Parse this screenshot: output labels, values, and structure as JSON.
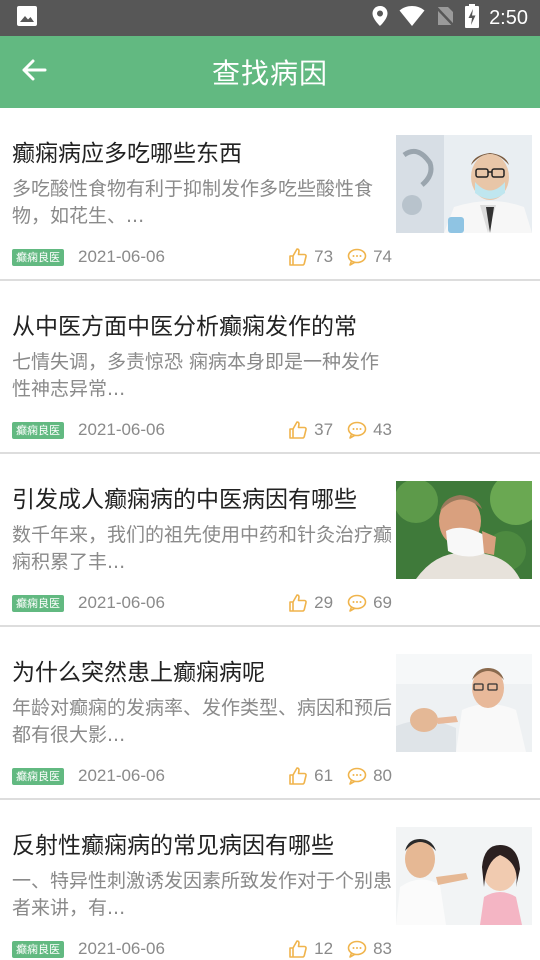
{
  "status_bar": {
    "time": "2:50",
    "icons": [
      "image-icon",
      "location-icon",
      "wifi-icon",
      "no-sim-icon",
      "battery-charging-icon"
    ]
  },
  "header": {
    "title": "查找病因",
    "back_icon": "arrow-left-icon",
    "background_color": "#62b981"
  },
  "articles": [
    {
      "title": "癫痫病应多吃哪些东西",
      "summary": "多吃酸性食物有利于抑制发作多吃些酸性食物，如花生、...",
      "tag": "癫痫良医",
      "date": "2021-06-06",
      "likes": "73",
      "comments": "74",
      "thumbnail": "doctor-with-mask"
    },
    {
      "title": "从中医方面中医分析癫痫发作的常",
      "summary": "七情失调，多责惊恐 痫病本身即是一种发作性神志异常...",
      "tag": "癫痫良医",
      "date": "2021-06-06",
      "likes": "37",
      "comments": "43"
    },
    {
      "title": "引发成人癫痫病的中医病因有哪些",
      "summary": "数千年来，我们的祖先使用中药和针灸治疗癫痫积累了丰...",
      "tag": "癫痫良医",
      "date": "2021-06-06",
      "likes": "29",
      "comments": "69",
      "thumbnail": "man-with-tissue"
    },
    {
      "title": "为什么突然患上癫痫病呢",
      "summary": "年龄对癫痫的发病率、发作类型、病因和预后都有很大影...",
      "tag": "癫痫良医",
      "date": "2021-06-06",
      "likes": "61",
      "comments": "80",
      "thumbnail": "doctor-examining-patient"
    },
    {
      "title": "反射性癫痫病的常见病因有哪些",
      "summary": "一、特异性刺激诱发因素所致发作对于个别患者来讲，有...",
      "tag": "癫痫良医",
      "date": "2021-06-06",
      "likes": "12",
      "comments": "83",
      "thumbnail": "doctor-with-child"
    }
  ],
  "colors": {
    "accent": "#62b981",
    "icon_orange": "#f0b44c",
    "status_bar": "#575757"
  }
}
